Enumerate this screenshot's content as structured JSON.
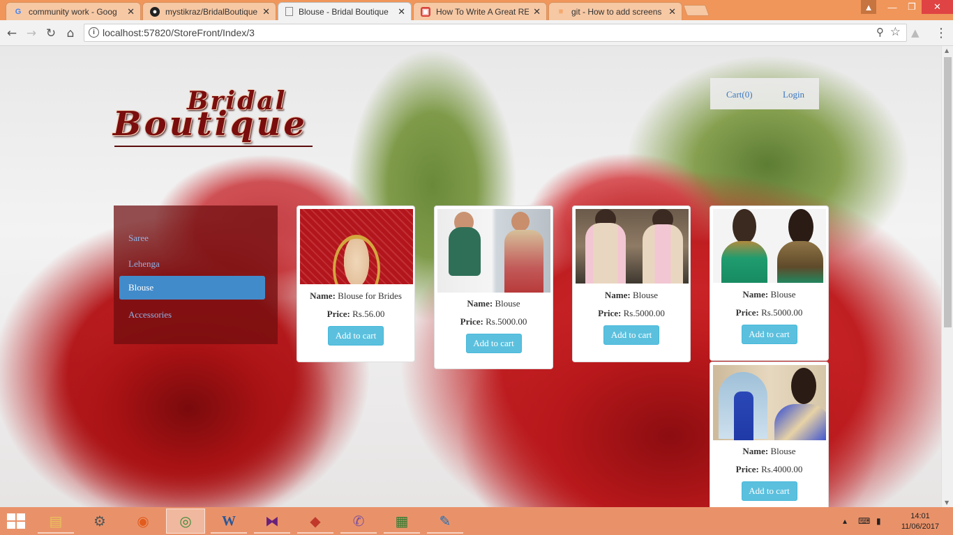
{
  "browser": {
    "tabs": [
      {
        "title": "community work - Goog",
        "icon": "google-icon"
      },
      {
        "title": "mystikraz/BridalBoutique",
        "icon": "github-icon"
      },
      {
        "title": "Blouse - Bridal Boutique",
        "icon": "page-icon",
        "active": true
      },
      {
        "title": "How To Write A Great RE",
        "icon": "blog-icon"
      },
      {
        "title": "git - How to add screens",
        "icon": "stackoverflow-icon"
      }
    ],
    "url": "localhost:57820/StoreFront/Index/3"
  },
  "site": {
    "logo_line1": "Bridal",
    "logo_line2": "Boutique",
    "nav": {
      "cart": "Cart(0)",
      "login": "Login"
    },
    "categories": [
      {
        "label": "Saree"
      },
      {
        "label": "Lehenga"
      },
      {
        "label": "Blouse",
        "active": true
      },
      {
        "label": "Accessories"
      }
    ],
    "name_label": "Name:",
    "price_label": "Price:",
    "button_label": "Add to cart",
    "products": [
      {
        "name": "Blouse for Brides",
        "price": "Rs.56.00"
      },
      {
        "name": "Blouse",
        "price": "Rs.5000.00"
      },
      {
        "name": "Blouse",
        "price": "Rs.5000.00"
      },
      {
        "name": "Blouse",
        "price": "Rs.5000.00"
      },
      {
        "name": "Blouse",
        "price": "Rs.4000.00"
      }
    ]
  },
  "taskbar": {
    "apps": [
      "file-explorer-icon",
      "control-panel-icon",
      "firefox-icon",
      "chrome-icon",
      "word-icon",
      "visual-studio-icon",
      "git-extensions-icon",
      "viber-icon",
      "office-app-icon",
      "paint-icon"
    ],
    "time": "14:01",
    "date": "11/06/2017"
  },
  "colors": {
    "accent": "#428bca",
    "button": "#5bc0de",
    "tabbar": "#f0965a",
    "taskbar": "#e9926a"
  }
}
